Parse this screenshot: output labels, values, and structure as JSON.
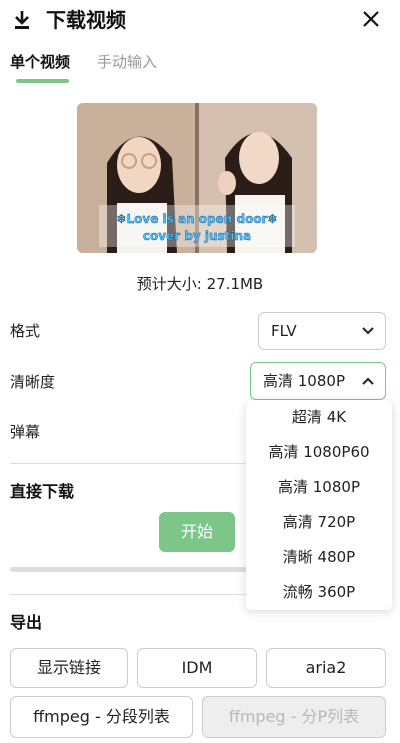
{
  "header": {
    "title": "下载视频"
  },
  "tabs": [
    {
      "label": "单个视频"
    },
    {
      "label": "手动输入"
    }
  ],
  "video": {
    "caption_line1": "❄Love is an open door❄",
    "caption_line2": "cover by justina"
  },
  "estimate": {
    "text": "预计大小: 27.1MB"
  },
  "format": {
    "label": "格式",
    "value": "FLV"
  },
  "quality": {
    "label": "清晰度",
    "value": "高清 1080P",
    "options": [
      "超清 4K",
      "高清 1080P60",
      "高清 1080P",
      "高清 720P",
      "清晰 480P",
      "流畅 360P"
    ]
  },
  "danmaku": {
    "label": "弹幕"
  },
  "direct_download": {
    "title": "直接下载",
    "start_label": "开始",
    "progress": 0
  },
  "export": {
    "title": "导出",
    "buttons": [
      "显示链接",
      "IDM",
      "aria2"
    ],
    "buttons_row2": [
      "ffmpeg - 分段列表",
      "ffmpeg - 分P列表"
    ]
  },
  "colors": {
    "accent": "#7cc68a",
    "border": "#cccccc",
    "text": "#222222"
  },
  "icons": {
    "download": "download-icon",
    "close": "close-icon",
    "chevron_down": "chevron-down-icon",
    "chevron_up": "chevron-up-icon"
  }
}
